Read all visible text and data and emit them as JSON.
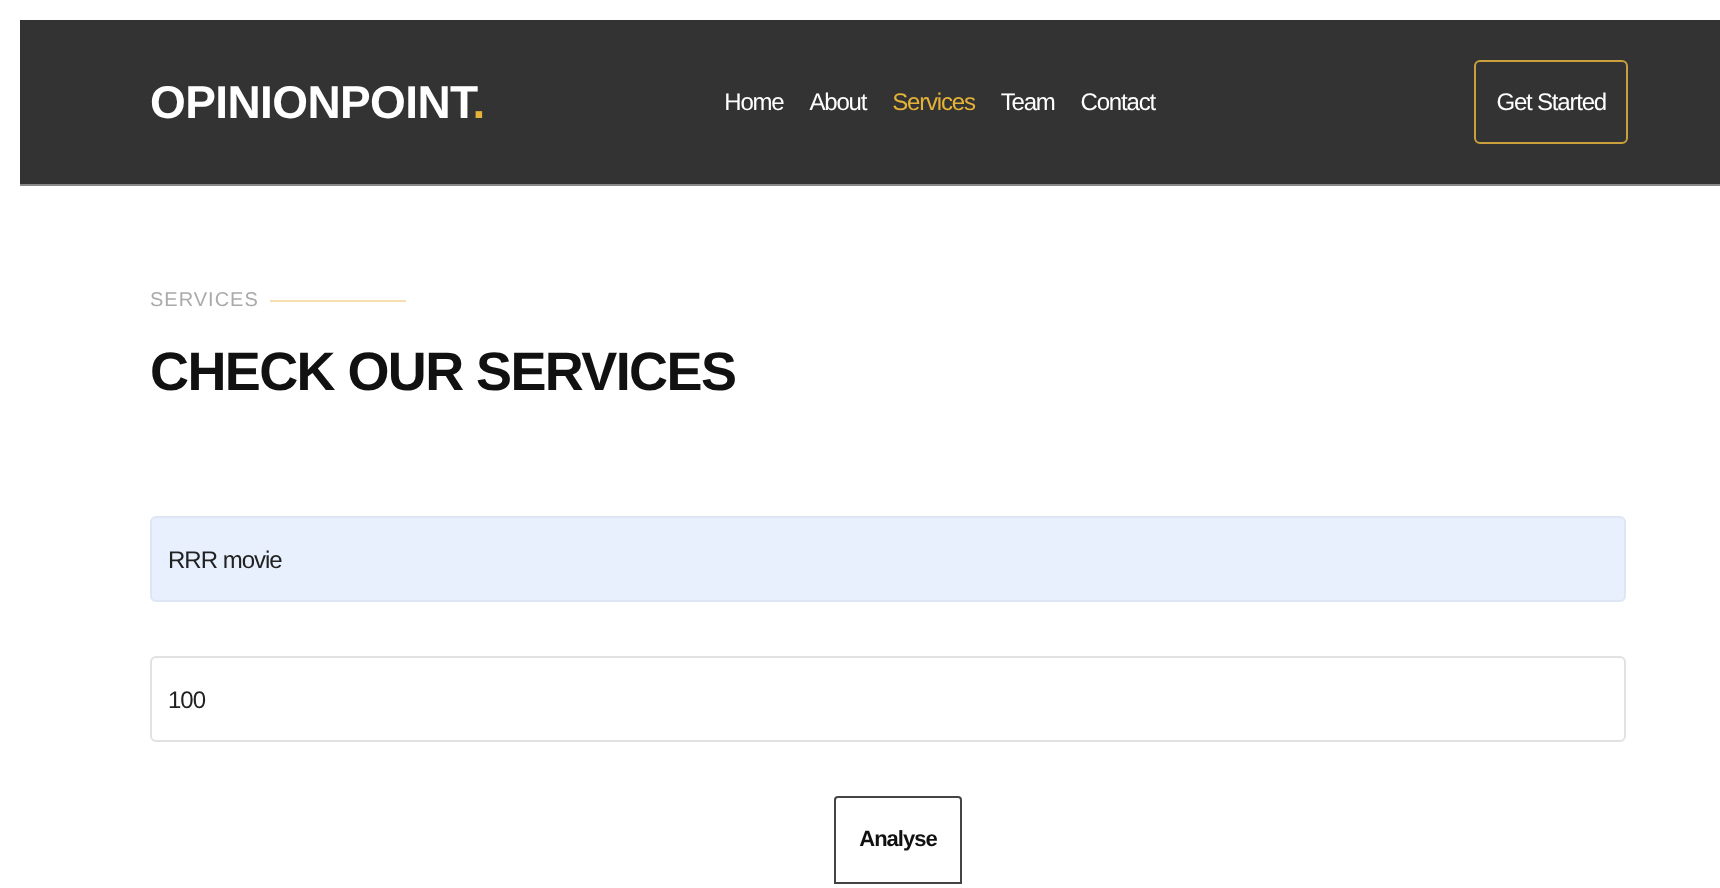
{
  "header": {
    "logo": {
      "name": "OPINIONPOINT",
      "dot": "."
    },
    "nav": [
      {
        "label": "Home",
        "selected": false
      },
      {
        "label": "About",
        "selected": false
      },
      {
        "label": "Services",
        "selected": true
      },
      {
        "label": "Team",
        "selected": false
      },
      {
        "label": "Contact",
        "selected": false
      }
    ],
    "cta": "Get Started"
  },
  "section": {
    "eyebrow": "SERVICES",
    "title": "CHECK OUR SERVICES"
  },
  "form": {
    "fields": [
      {
        "value": "RRR movie",
        "autofilled": true
      },
      {
        "value": "100",
        "autofilled": false
      }
    ],
    "submit": "Analyse"
  }
}
